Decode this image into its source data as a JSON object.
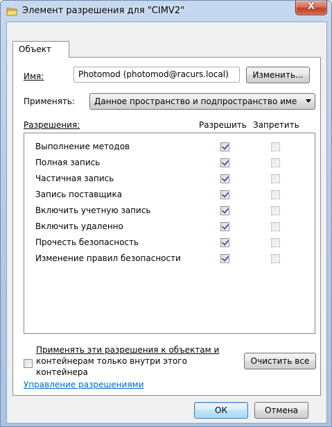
{
  "window": {
    "title": "Элемент разрешения для \"CIMV2\"",
    "close_glyph": "X"
  },
  "tabs": [
    {
      "label": "Объект"
    }
  ],
  "name_field": {
    "label": "Имя:",
    "value": "Photomod (photomod@racurs.local)",
    "change_button": "Изменить..."
  },
  "apply_to": {
    "label": "Применять:",
    "selected": "Данное пространство и подпространство име"
  },
  "permissions": {
    "label": "Разрешения:",
    "allow_header": "Разрешить",
    "deny_header": "Запретить",
    "items": [
      {
        "name": "Выполнение методов",
        "allow": true,
        "deny": false
      },
      {
        "name": "Полная запись",
        "allow": true,
        "deny": false
      },
      {
        "name": "Частичная запись",
        "allow": true,
        "deny": false
      },
      {
        "name": "Запись поставщика",
        "allow": true,
        "deny": false
      },
      {
        "name": "Включить учетную запись",
        "allow": true,
        "deny": false
      },
      {
        "name": "Включить удаленно",
        "allow": true,
        "deny": false
      },
      {
        "name": "Прочесть безопасность",
        "allow": true,
        "deny": false
      },
      {
        "name": "Изменение правил безопасности",
        "allow": true,
        "deny": false
      }
    ]
  },
  "apply_inside": {
    "line1": "Применять эти разрешения к объектам и",
    "line2": "контейнерам только внутри этого",
    "line3": "контейнера",
    "checked": false
  },
  "clear_all_button": "Очистить все",
  "manage_link": "Управление разрешениями",
  "ok_button": "ОК",
  "cancel_button": "Отмена",
  "colors": {
    "accent": "#3c7fb1",
    "link": "#0066cc",
    "close": "#c4402a"
  }
}
